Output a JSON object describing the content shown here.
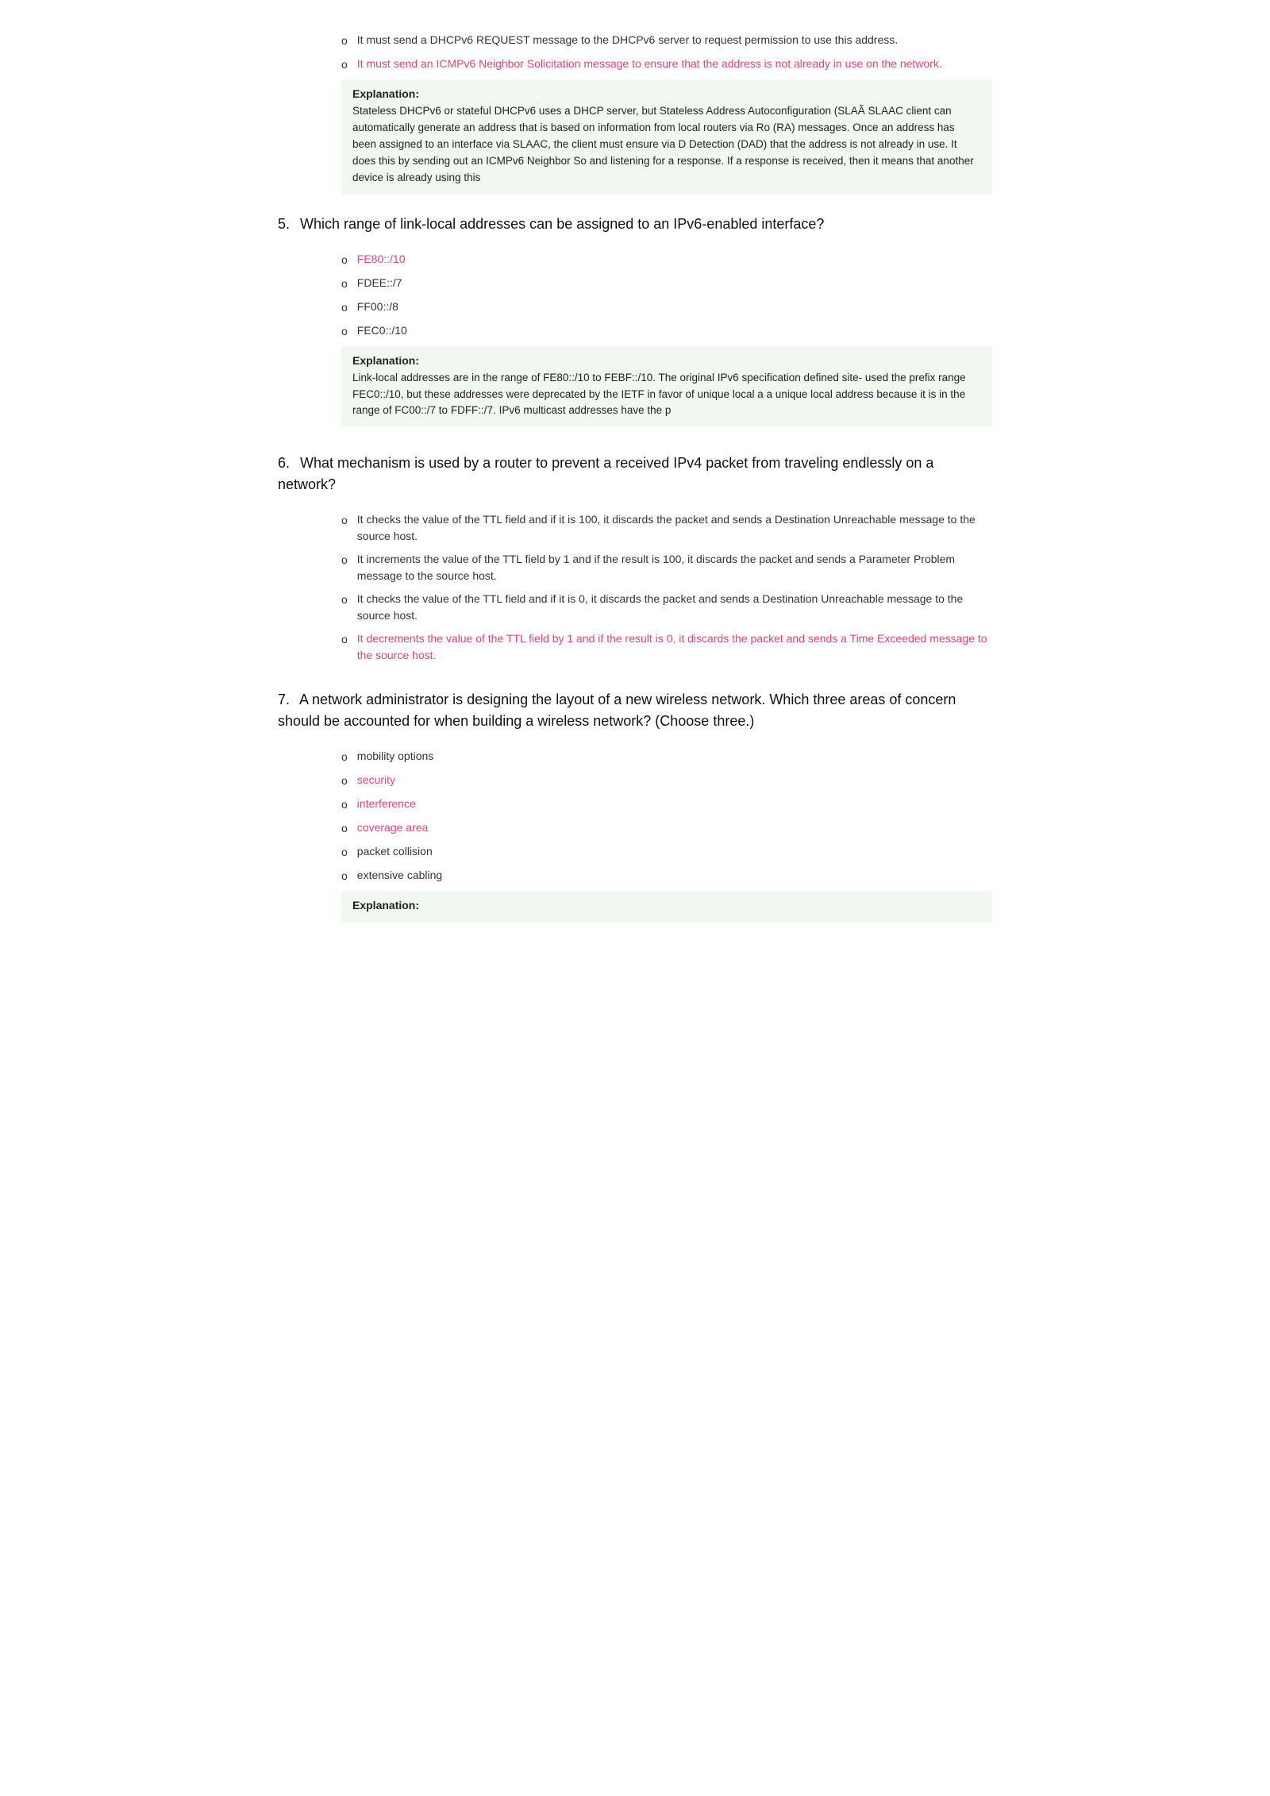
{
  "page": {
    "continuation": {
      "options": [
        {
          "id": "cont-opt1",
          "text": "It must send a DHCPv6 REQUEST message to the DHCPv6 server to request permission to use this address.",
          "correct": false
        },
        {
          "id": "cont-opt2",
          "text": "It must send an ICMPv6 Neighbor Solicitation message to ensure that the address is not already in use on the network.",
          "correct": true
        }
      ],
      "explanation_label": "Explanation:",
      "explanation_text": "Stateless DHCPv6 or stateful DHCPv6 uses a DHCP server, but Stateless Address Autoconfiguration (SLAÃ SLAAC client can automatically generate an address that is based on information from local routers via Ro (RA) messages. Once an address has been assigned to an interface via SLAAC, the client must ensure via D Detection (DAD) that the address is not already in use. It does this by sending out an ICMPv6 Neighbor So and listening for a response. If a response is received, then it means that another device is already using this"
    },
    "questions": [
      {
        "number": "5.",
        "text": "Which range of link-local addresses can be assigned to an IPv6-enabled interface?",
        "options": [
          {
            "id": "q5-opt1",
            "text": "FE80::/10",
            "correct": true
          },
          {
            "id": "q5-opt2",
            "text": "FDEE::/7",
            "correct": false
          },
          {
            "id": "q5-opt3",
            "text": "FF00::/8",
            "correct": false
          },
          {
            "id": "q5-opt4",
            "text": "FEC0::/10",
            "correct": false
          }
        ],
        "explanation_label": "Explanation:",
        "explanation_text": "Link-local addresses are in the range of FE80::/10 to FEBF::/10. The original IPv6 specification defined site- used the prefix range FEC0::/10, but these addresses were deprecated by the IETF in favor of unique local a a unique local address because it is in the range of FC00::/7 to FDFF::/7. IPv6 multicast addresses have the p"
      },
      {
        "number": "6.",
        "text": "What mechanism is used by a router to prevent a received IPv4 packet from traveling endlessly on a network?",
        "options": [
          {
            "id": "q6-opt1",
            "text": "It checks the value of the TTL field and if it is 100, it discards the packet and sends a Destination Unreachable message to the source host.",
            "correct": false
          },
          {
            "id": "q6-opt2",
            "text": "It increments the value of the TTL field by 1 and if the result is 100, it discards the packet and sends a Parameter Problem message to the source host.",
            "correct": false
          },
          {
            "id": "q6-opt3",
            "text": "It checks the value of the TTL field and if it is 0, it discards the packet and sends a Destination Unreachable message to the source host.",
            "correct": false
          },
          {
            "id": "q6-opt4",
            "text": "It decrements the value of the TTL field by 1 and if the result is 0, it discards the packet and sends a Time Exceeded message to the source host.",
            "correct": true
          }
        ]
      },
      {
        "number": "7.",
        "text": "A network administrator is designing the layout of a new wireless network. Which three areas of concern should be accounted for when building a wireless network? (Choose three.)",
        "options": [
          {
            "id": "q7-opt1",
            "text": "mobility options",
            "correct": false
          },
          {
            "id": "q7-opt2",
            "text": "security",
            "correct": true
          },
          {
            "id": "q7-opt3",
            "text": "interference",
            "correct": true
          },
          {
            "id": "q7-opt4",
            "text": "coverage area",
            "correct": true
          },
          {
            "id": "q7-opt5",
            "text": "packet collision",
            "correct": false
          },
          {
            "id": "q7-opt6",
            "text": "extensive cabling",
            "correct": false
          }
        ],
        "explanation_label": "Explanation:",
        "explanation_text": ""
      }
    ],
    "bullet_char": "o"
  }
}
